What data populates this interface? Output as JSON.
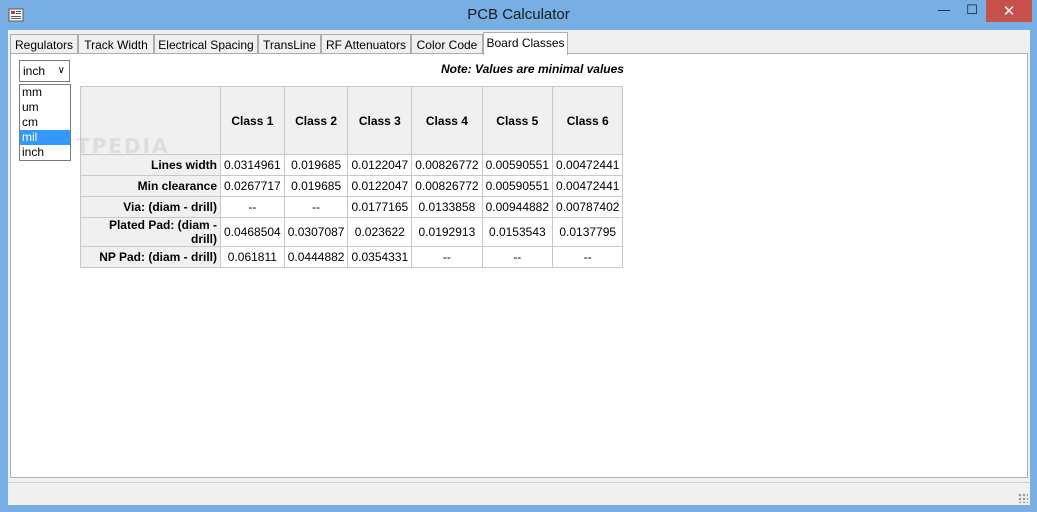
{
  "window": {
    "title": "PCB Calculator",
    "min_glyph": "—",
    "max_glyph": "☐",
    "close_glyph": "✕"
  },
  "tabs": [
    {
      "label": "Regulators"
    },
    {
      "label": "Track Width"
    },
    {
      "label": "Electrical Spacing"
    },
    {
      "label": "TransLine"
    },
    {
      "label": "RF Attenuators"
    },
    {
      "label": "Color Code"
    },
    {
      "label": "Board Classes",
      "active": true
    }
  ],
  "units": {
    "selected": "inch",
    "options": [
      "mm",
      "um",
      "cm",
      "mil",
      "inch"
    ],
    "highlighted": "mil"
  },
  "note": "Note: Values are minimal values",
  "table": {
    "columns": [
      "Class 1",
      "Class 2",
      "Class 3",
      "Class 4",
      "Class 5",
      "Class 6"
    ],
    "rows": [
      {
        "label": "Lines width",
        "values": [
          "0.0314961",
          "0.019685",
          "0.0122047",
          "0.00826772",
          "0.00590551",
          "0.00472441"
        ]
      },
      {
        "label": "Min clearance",
        "values": [
          "0.0267717",
          "0.019685",
          "0.0122047",
          "0.00826772",
          "0.00590551",
          "0.00472441"
        ]
      },
      {
        "label": "Via: (diam - drill)",
        "values": [
          "--",
          "--",
          "0.0177165",
          "0.0133858",
          "0.00944882",
          "0.00787402"
        ]
      },
      {
        "label": "Plated Pad: (diam - drill)",
        "values": [
          "0.0468504",
          "0.0307087",
          "0.023622",
          "0.0192913",
          "0.0153543",
          "0.0137795"
        ]
      },
      {
        "label": "NP Pad: (diam - drill)",
        "values": [
          "0.061811",
          "0.0444882",
          "0.0354331",
          "--",
          "--",
          "--"
        ]
      }
    ]
  },
  "watermark": "SOFTPEDIA"
}
